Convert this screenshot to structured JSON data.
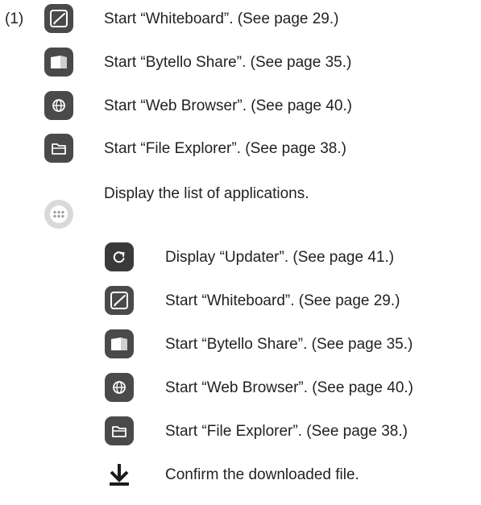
{
  "step_marker": "(1)",
  "items": [
    {
      "icon": "whiteboard-icon",
      "text": "Start “Whiteboard”. (See page 29.)"
    },
    {
      "icon": "bytello-share-icon",
      "text": "Start “Bytello Share”. (See page 35.)"
    },
    {
      "icon": "web-browser-icon",
      "text": "Start “Web Browser”. (See page 40.)"
    },
    {
      "icon": "file-explorer-icon",
      "text": "Start “File Explorer”. (See page 38.)"
    },
    {
      "icon": "app-list-icon",
      "text": "Display the list of applications."
    }
  ],
  "sub_items": [
    {
      "icon": "updater-icon",
      "text": "Display “Updater”. (See page 41.)"
    },
    {
      "icon": "whiteboard-icon",
      "text": "Start “Whiteboard”. (See page 29.)"
    },
    {
      "icon": "bytello-share-icon",
      "text": "Start “Bytello Share”. (See page 35.)"
    },
    {
      "icon": "web-browser-icon",
      "text": "Start “Web Browser”. (See page 40.)"
    },
    {
      "icon": "file-explorer-icon",
      "text": "Start “File Explorer”. (See page 38.)"
    },
    {
      "icon": "download-icon",
      "text": "Confirm the downloaded file."
    }
  ],
  "colors": {
    "text": "#231f20",
    "icon_tile": "#4a4a4a",
    "icon_glyph": "#ffffff",
    "app_list_circle": "#d9d9d9",
    "download_glyph": "#1a1a1a"
  }
}
